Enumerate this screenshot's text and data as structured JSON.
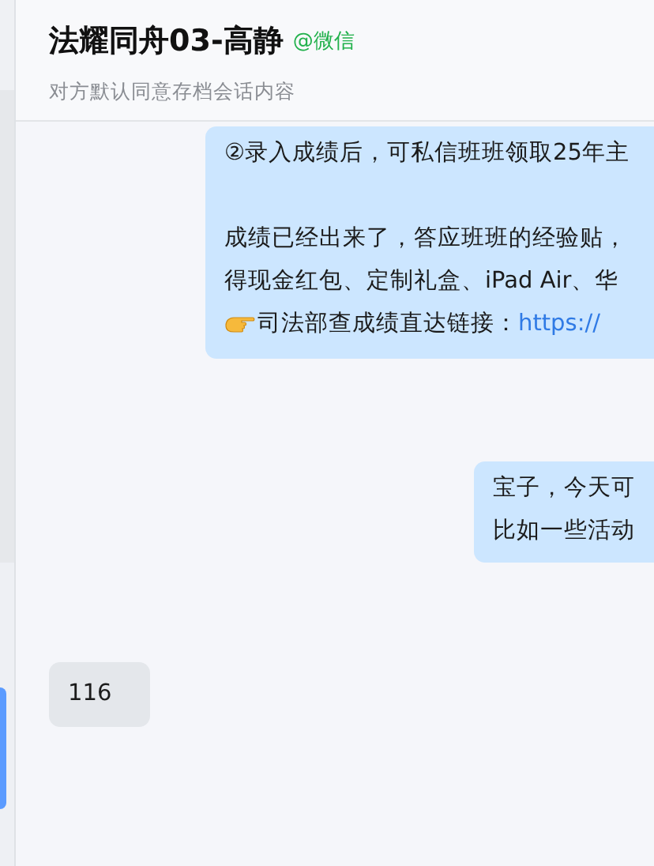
{
  "header": {
    "title": "法耀同舟03-高静",
    "source": "@微信",
    "subtitle": "对方默认同意存档会话内容"
  },
  "messages": [
    {
      "kind": "outgoing",
      "lines": [
        {
          "kind": "text",
          "text": "②录入成绩后，可私信班班领取25年主"
        },
        {
          "kind": "gap"
        },
        {
          "kind": "text",
          "text": "成绩已经出来了，答应班班的经验贴，"
        },
        {
          "kind": "text",
          "text": "得现金红包、定制礼盒、iPad Air、华"
        },
        {
          "kind": "pointer",
          "text": "司法部查成绩直达链接：",
          "link": "https://"
        }
      ]
    },
    {
      "kind": "outgoing",
      "lines": [
        {
          "kind": "text",
          "text": "宝子，今天可"
        },
        {
          "kind": "text",
          "text": "比如一些活动"
        }
      ]
    },
    {
      "kind": "incoming",
      "lines": [
        {
          "kind": "text",
          "text": "116"
        }
      ]
    }
  ]
}
